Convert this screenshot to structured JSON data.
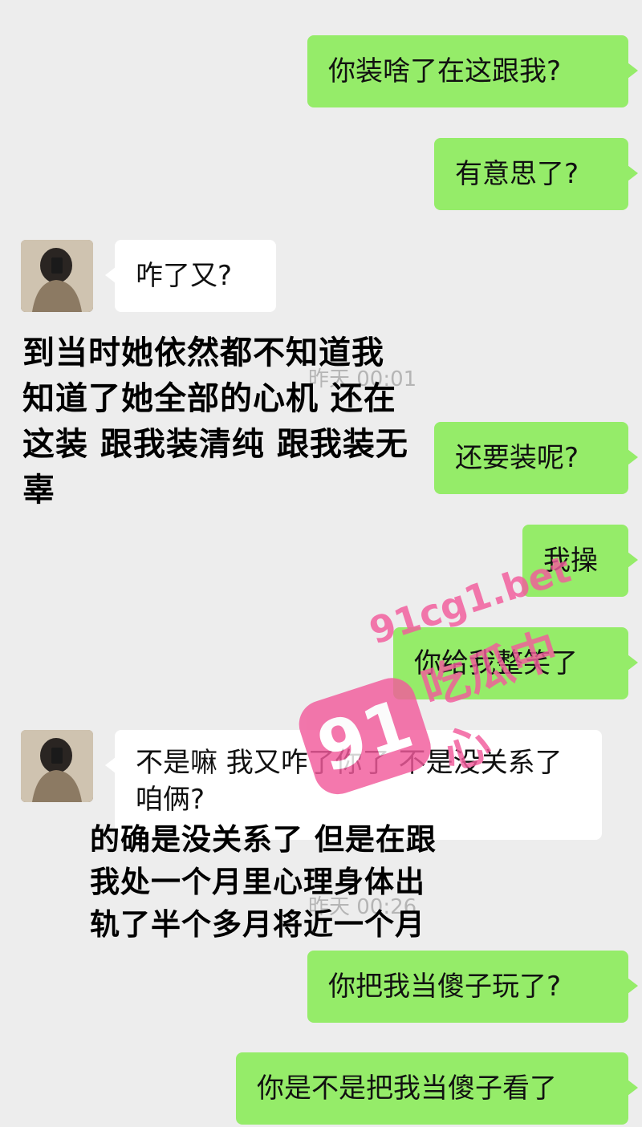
{
  "messages": [
    {
      "side": "out",
      "text": "你装啥了在这跟我?"
    },
    {
      "side": "out",
      "text": "有意思了?"
    },
    {
      "side": "in",
      "text": "咋了又?"
    },
    {
      "side": "out",
      "text": "还要装呢?"
    },
    {
      "side": "out",
      "text": "我操"
    },
    {
      "side": "out",
      "text": "你给我整笑了"
    },
    {
      "side": "in",
      "text": "不是嘛  我又咋了你了  不是没关系了咱俩?"
    },
    {
      "side": "out",
      "text": "你把我当傻子玩了?"
    },
    {
      "side": "out",
      "text": "你是不是把我当傻子看了"
    }
  ],
  "timestamps": [
    "昨天 00:01",
    "昨天 00:26"
  ],
  "overlay_1": [
    "到当时她依然都不知道我",
    "知道了她全部的心机 还在",
    "这装 跟我装清纯 跟我装无",
    "辜"
  ],
  "overlay_2": [
    "的确是没关系了 但是在跟",
    "我处一个月里心理身体出",
    "轨了半个多月将近一个月"
  ],
  "watermark": {
    "badge": "91",
    "url": "91cg1.bet",
    "name": "吃瓜中心"
  },
  "colors": {
    "background": "#ededed",
    "outgoing_bubble": "#95ec69",
    "incoming_bubble": "#ffffff",
    "watermark": "#f25b9c"
  }
}
